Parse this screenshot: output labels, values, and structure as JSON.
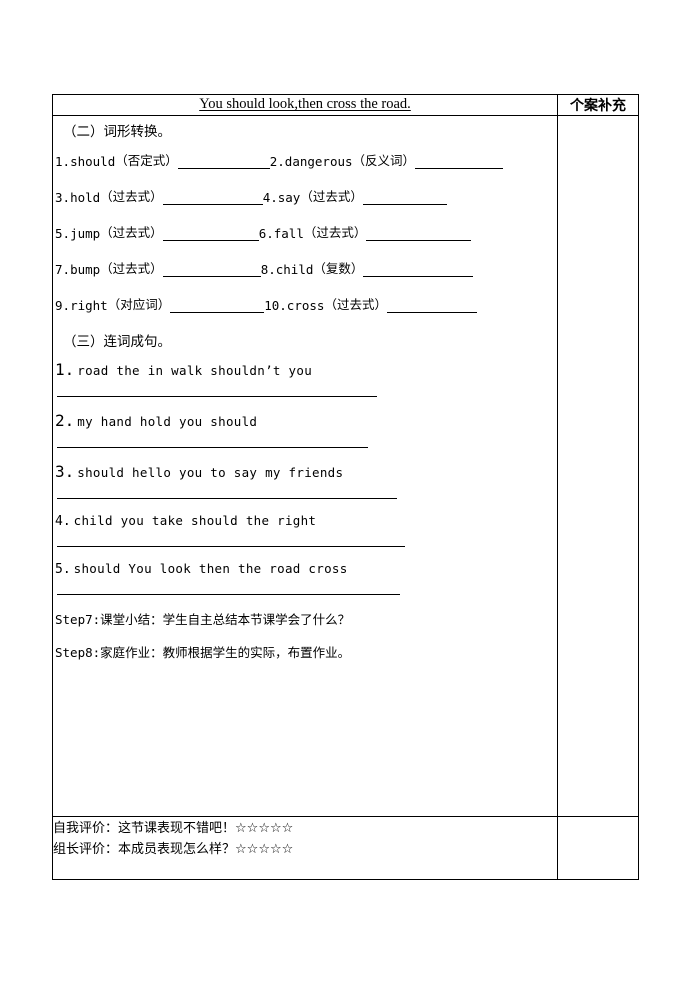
{
  "header": {
    "title": "You should look,then cross the road.",
    "side_column_label": "个案补充",
    "side_column_content": ""
  },
  "section_word_transform": {
    "heading": "（二）词形转换。",
    "items": [
      {
        "num": "1.",
        "word": "should",
        "hint": "（否定式）"
      },
      {
        "num": "2.",
        "word": "dangerous",
        "hint": "（反义词）"
      },
      {
        "num": "3.",
        "word": "hold",
        "hint": "（过去式）"
      },
      {
        "num": "4.",
        "word": "say",
        "hint": "（过去式）"
      },
      {
        "num": "5.",
        "word": "jump",
        "hint": "（过去式）"
      },
      {
        "num": "6.",
        "word": "fall",
        "hint": "（过去式）"
      },
      {
        "num": "7.",
        "word": "bump",
        "hint": "（过去式）"
      },
      {
        "num": "8.",
        "word": "child",
        "hint": "（复数）"
      },
      {
        "num": "9.",
        "word": "right",
        "hint": "（对应词）"
      },
      {
        "num": "10.",
        "word": "cross",
        "hint": "（过去式）"
      }
    ]
  },
  "section_sentence_order": {
    "heading": "（三）连词成句。",
    "items": [
      {
        "num": "1.",
        "words": "road  the  in  walk  shouldn’t  you"
      },
      {
        "num": "2.",
        "words": "my  hand  hold  you  should"
      },
      {
        "num": "3.",
        "words": "should  hello  you  to  say  my  friends"
      },
      {
        "num": "4.",
        "words": "child  you  take  should  the  right"
      },
      {
        "num": "5.",
        "words": "should  You  look  then  the  road  cross"
      }
    ]
  },
  "steps": [
    {
      "lead": "Step7:",
      "text": "课堂小结：学生自主总结本节课学会了什么？"
    },
    {
      "lead": "Step8:",
      "text": "家庭作业：教师根据学生的实际，布置作业。"
    }
  ],
  "evaluation": {
    "self_label": "自我评价：这节课表现不错吧！",
    "self_stars": "☆☆☆☆☆",
    "leader_label": "组长评价：本成员表现怎么样？",
    "leader_stars": "☆☆☆☆☆",
    "side_content": ""
  }
}
